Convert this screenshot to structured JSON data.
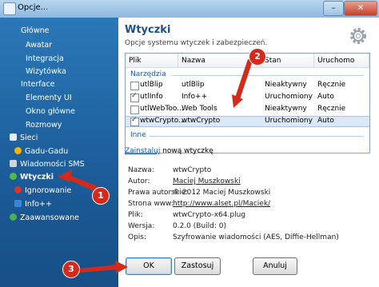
{
  "window": {
    "title": "Opcje..."
  },
  "sidebar": {
    "items": [
      {
        "label": "Główne"
      },
      {
        "label": "Awatar"
      },
      {
        "label": "Integracja"
      },
      {
        "label": "Wizytówka"
      },
      {
        "label": "Interface"
      },
      {
        "label": "Elementy UI"
      },
      {
        "label": "Okno główne"
      },
      {
        "label": "Rozmowy"
      },
      {
        "label": "Sieci"
      },
      {
        "label": "Gadu-Gadu"
      },
      {
        "label": "Wiadomości SMS"
      },
      {
        "label": "Wtyczki"
      },
      {
        "label": "Ignorowanie"
      },
      {
        "label": "Info++"
      },
      {
        "label": "Zaawansowane"
      }
    ]
  },
  "panel": {
    "title": "Wtyczki",
    "subtitle": "Opcje systemu wtyczek i zabezpieczeń.",
    "columns": [
      "Plik",
      "Nazwa",
      "Stan",
      "Uruchomo"
    ],
    "groups": [
      {
        "label": "Narzędzia"
      },
      {
        "label": "Inne"
      }
    ],
    "rows": [
      {
        "file": "utlBlip",
        "name": "utlBlip",
        "state": "Nieaktywny",
        "run": "Ręcznie",
        "checked": false
      },
      {
        "file": "utlInfo",
        "name": "Info++",
        "state": "Uruchomiony",
        "run": "Auto",
        "checked": true
      },
      {
        "file": "utlWebToo...",
        "name": "Web Tools",
        "state": "Nieaktywny",
        "run": "Ręcznie",
        "checked": false
      },
      {
        "file": "wtwCrypto...",
        "name": "wtwCrypto",
        "state": "Uruchomiony",
        "run": "Auto",
        "checked": true
      }
    ],
    "install_link": "Zainstaluj",
    "install_rest": " nową wtyczkę",
    "details": {
      "labels": [
        "Nazwa:",
        "Autor:",
        "Prawa autorskie:",
        "Strona www:",
        "Plik:",
        "Wersja:",
        "Opis:"
      ],
      "name": "wtwCrypto",
      "author": "Maciej Muszkowski",
      "copyright": "© 2012 Maciej Muszkowski",
      "www": "http://www.alset.pl/Maciek/",
      "file": "wtwCrypto-x64.plug",
      "version": "0.2.0 (Build: 0)",
      "description": "Szyfrowanie wiadomości (AES, Diffie-Hellman)"
    }
  },
  "buttons": {
    "ok": "OK",
    "cancel": "Zastosuj",
    "apply": "Anuluj"
  },
  "annotations": [
    "1",
    "2",
    "3"
  ],
  "colors": {
    "sidebar": "#1f5f9b",
    "title_accent": "#1f4f86",
    "arrow": "#d42a1c",
    "selected_row": "#dbe8f7"
  }
}
